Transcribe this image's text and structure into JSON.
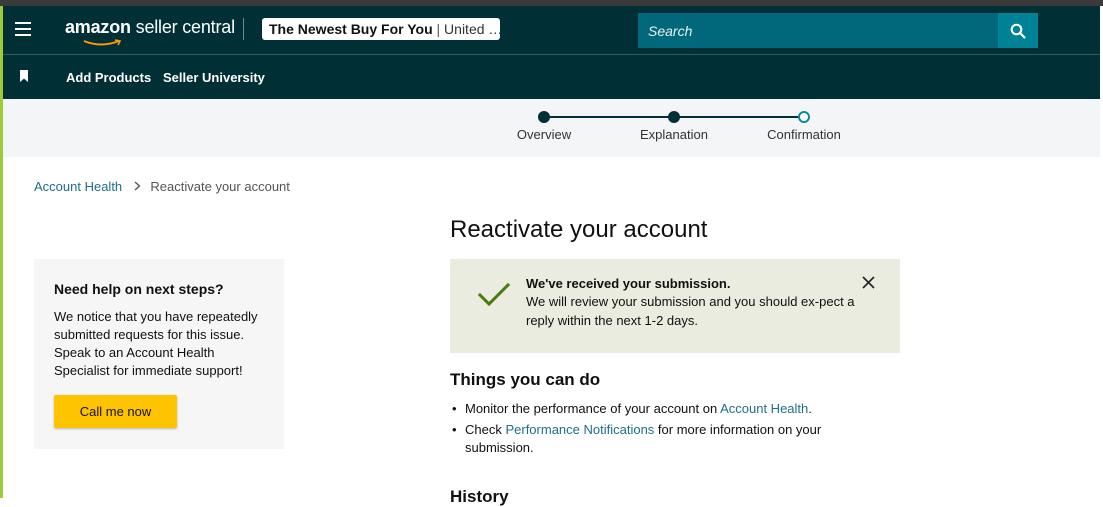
{
  "header": {
    "logo_brand": "amazon",
    "logo_product": "seller central",
    "store_name": "The Newest Buy For You",
    "store_separator": "|",
    "store_region": "United …",
    "search_placeholder": "Search"
  },
  "subnav": {
    "add_products": "Add Products",
    "seller_university": "Seller University"
  },
  "stepper": {
    "steps": [
      {
        "label": "Overview",
        "state": "complete"
      },
      {
        "label": "Explanation",
        "state": "complete"
      },
      {
        "label": "Confirmation",
        "state": "current"
      }
    ]
  },
  "breadcrumb": {
    "parent": "Account Health",
    "current": "Reactivate your account"
  },
  "help_card": {
    "title": "Need help on next steps?",
    "body": "We notice that you have repeatedly submitted requests for this issue. Speak to an Account Health Specialist for immediate support!",
    "button": "Call me now"
  },
  "main": {
    "title": "Reactivate your account",
    "alert": {
      "title": "We've received your submission.",
      "message": "We will review your submission and you should ex-pect a reply within the next 1-2 days."
    },
    "things_title": "Things you can do",
    "item1": {
      "prefix": "Monitor the performance of your account on ",
      "link": "Account Health",
      "suffix": "."
    },
    "item2": {
      "prefix": "Check ",
      "link": "Performance Notifications",
      "suffix": " for more information on your submission."
    },
    "history_title": "History"
  },
  "colors": {
    "header_bg": "#002f36",
    "search_bg": "#00687a",
    "search_button": "#008296",
    "cta_yellow": "#ffc400",
    "link": "#1f6e8c",
    "success_green": "#4a7a12",
    "alert_bg": "#e9ecdf"
  },
  "icons": {
    "menu": "hamburger-icon",
    "search": "search-icon",
    "bookmark": "bookmark-icon",
    "breadcrumb_separator": "chevron-right-icon",
    "success": "checkmark-icon",
    "dismiss": "close-icon"
  }
}
